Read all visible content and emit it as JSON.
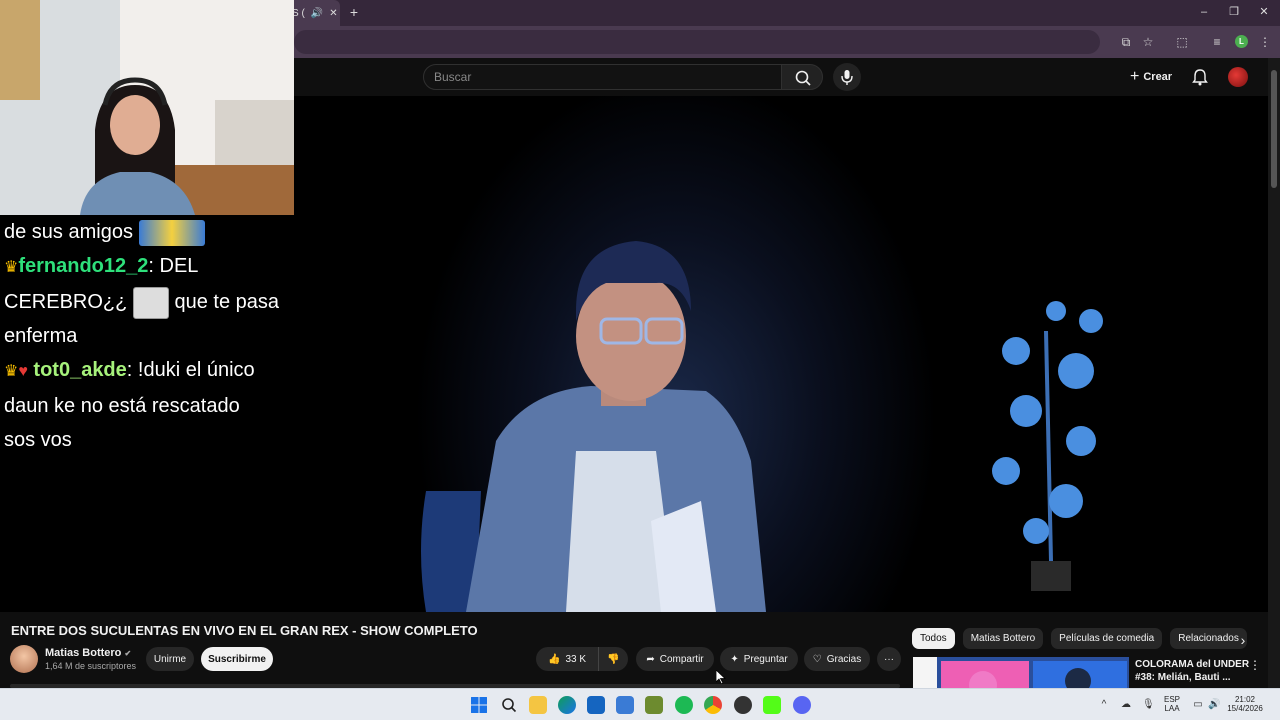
{
  "browser": {
    "tab_title_fragment": "S (",
    "close_tab_glyph": "✕",
    "new_tab_glyph": "+",
    "window_controls": [
      "–",
      "❐",
      "✕"
    ],
    "profile_initial": "L"
  },
  "youtube_header": {
    "search_placeholder": "Buscar",
    "create_label": "Crear"
  },
  "stream_chat": {
    "lines": [
      {
        "text": "de sus amigos"
      },
      {
        "user": "fernando12_2",
        "message_part1": ": DEL",
        "message_part2": "CEREBRO¿¿",
        "message_part3": "que te pasa",
        "message_part4": "enferma"
      },
      {
        "user": "tot0_akde",
        "message_part1": ": !duki el único",
        "message_part2": "daun ke no está rescatado",
        "message_part3": "sos vos"
      }
    ]
  },
  "video": {
    "title": "ENTRE DOS SUCULENTAS EN VIVO EN EL GRAN REX - SHOW COMPLETO",
    "channel_name": "Matias Bottero",
    "verified_glyph": "✔",
    "subscribers": "1,64 M de suscriptores",
    "join_label": "Unirme",
    "subscribe_label": "Suscribirme",
    "likes": "33 K",
    "share_label": "Compartir",
    "ask_label": "Preguntar",
    "thanks_label": "Gracias",
    "more_glyph": "···"
  },
  "recommendations": {
    "chips": [
      "Todos",
      "Matias Bottero",
      "Películas de comedia",
      "Relacionados"
    ],
    "next_glyph": "›",
    "first_item_title": "COLORAMA del UNDER #38: Melián, Bauti ...",
    "more_glyph": "⋮"
  },
  "taskbar": {
    "language_line1": "ESP",
    "language_line2": "LAA",
    "time": "21:02",
    "date": "15/4/2026",
    "chevron_glyph": "^"
  }
}
